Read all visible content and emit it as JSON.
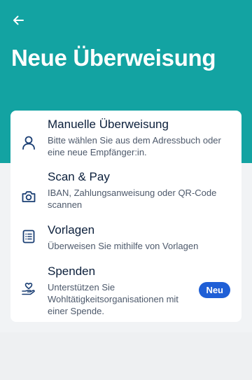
{
  "header": {
    "title": "Neue Überweisung",
    "background_color": "#13a3a2",
    "back_icon": "arrow-left-icon"
  },
  "options": [
    {
      "title": "Manuelle Überweisung",
      "description": "Bitte wählen Sie aus dem Adressbuch oder eine neue Empfänger:in.",
      "icon": "person-icon"
    },
    {
      "title": "Scan & Pay",
      "description": "IBAN, Zahlungsanweisung oder QR-Code scannen",
      "icon": "camera-icon"
    },
    {
      "title": "Vorlagen",
      "description": "Überweisen Sie mithilfe von Vorlagen",
      "icon": "list-document-icon"
    },
    {
      "title": "Spenden",
      "description": "Unterstützen Sie Wohltätigkeitsorganisationen mit einer Spende.",
      "icon": "heart-hand-icon",
      "badge": "Neu"
    }
  ],
  "colors": {
    "icon": "#1a3e73",
    "badge": "#1f5fd6",
    "title_text": "#0b1f3b",
    "description_text": "#4d596b"
  }
}
